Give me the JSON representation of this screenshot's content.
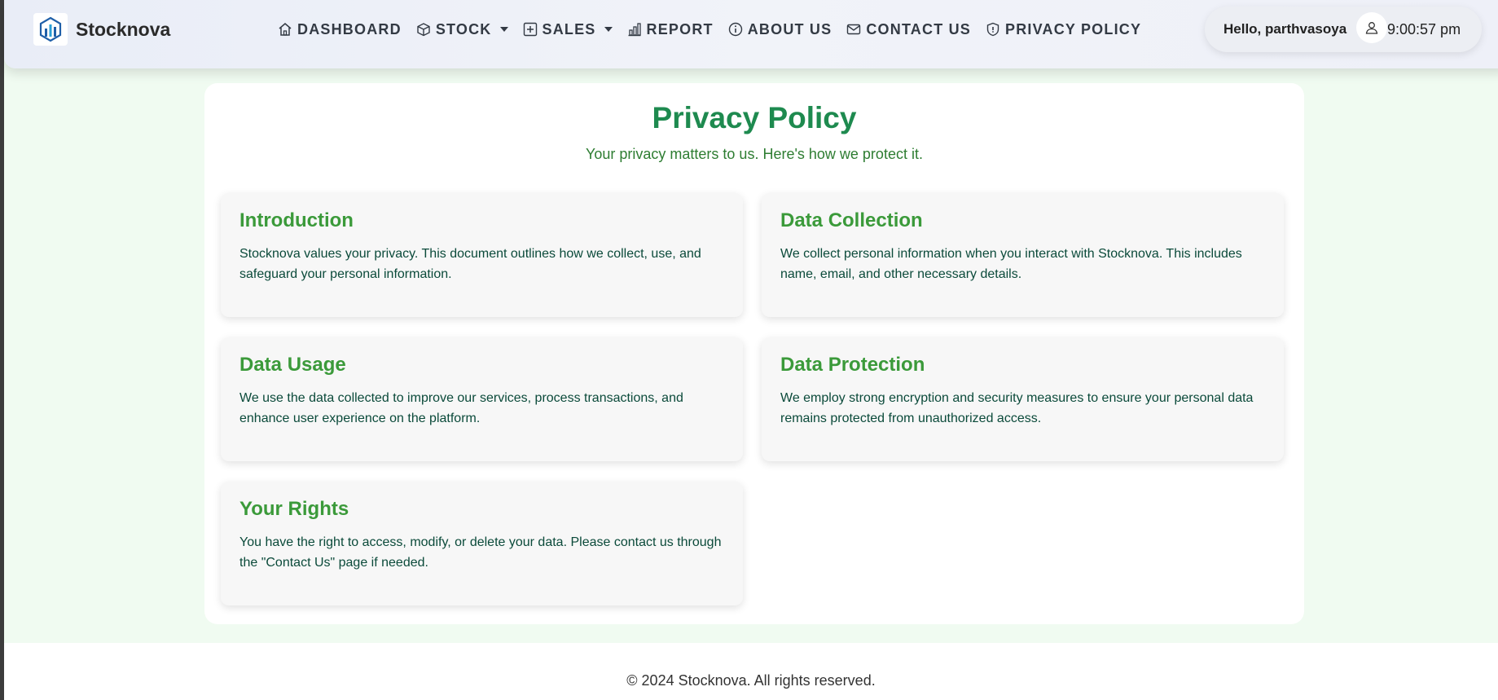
{
  "brand": {
    "name": "Stocknova"
  },
  "nav": {
    "items": [
      {
        "label": "DASHBOARD",
        "icon": "home-icon"
      },
      {
        "label": "STOCK",
        "icon": "box-icon",
        "dropdown": true
      },
      {
        "label": "SALES",
        "icon": "plus-square-icon",
        "dropdown": true
      },
      {
        "label": "REPORT",
        "icon": "bar-chart-icon"
      },
      {
        "label": "ABOUT US",
        "icon": "info-icon"
      },
      {
        "label": "CONTACT US",
        "icon": "envelope-icon"
      },
      {
        "label": "PRIVACY POLICY",
        "icon": "shield-icon"
      }
    ]
  },
  "user": {
    "greeting": "Hello, parthvasoya",
    "avatar_icon": "person-icon",
    "time": "9:00:57 pm"
  },
  "page": {
    "title": "Privacy Policy",
    "subtitle": "Your privacy matters to us. Here's how we protect it.",
    "sections": [
      {
        "title": "Introduction",
        "body": "Stocknova values your privacy. This document outlines how we collect, use, and safeguard your personal information."
      },
      {
        "title": "Data Collection",
        "body": "We collect personal information when you interact with Stocknova. This includes name, email, and other necessary details."
      },
      {
        "title": "Data Usage",
        "body": "We use the data collected to improve our services, process transactions, and enhance user experience on the platform."
      },
      {
        "title": "Data Protection",
        "body": "We employ strong encryption and security measures to ensure your personal data remains protected from unauthorized access."
      },
      {
        "title": "Your Rights",
        "body": "You have the right to access, modify, or delete your data. Please contact us through the \"Contact Us\" page if needed."
      }
    ]
  },
  "footer": {
    "text": "© 2024 Stocknova. All rights reserved."
  },
  "colors": {
    "title_green": "#1e8a4f",
    "section_heading_green": "#3b9a3a",
    "body_text": "#0b4a3a",
    "page_bg": "#f0fbf1"
  }
}
